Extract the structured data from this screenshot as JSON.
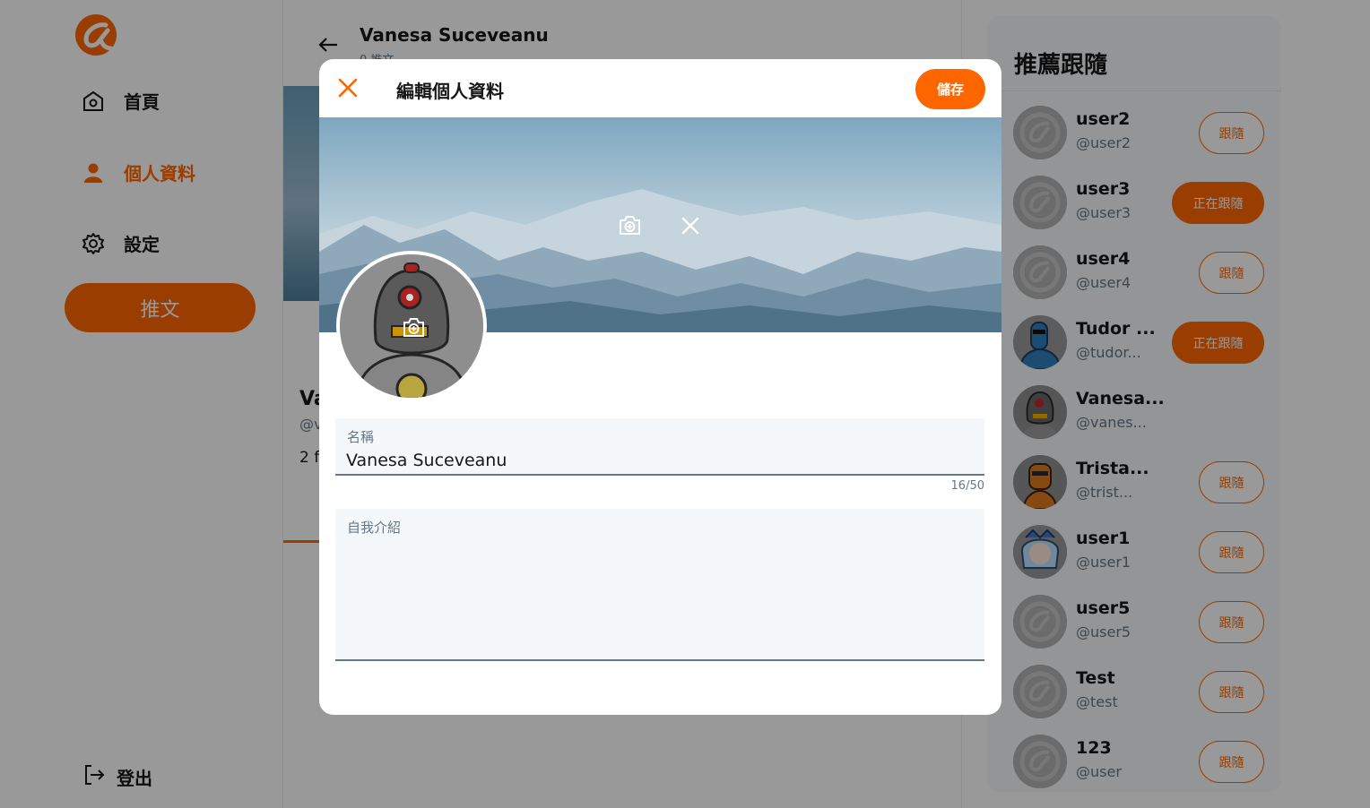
{
  "nav": {
    "items": [
      {
        "label": "首頁",
        "icon": "home-icon",
        "active": false
      },
      {
        "label": "個人資料",
        "icon": "user-icon",
        "active": true
      },
      {
        "label": "設定",
        "icon": "gear-icon",
        "active": false
      }
    ],
    "tweet_label": "推文",
    "logout_label": "登出"
  },
  "profile": {
    "name": "Vanesa Suceveanu",
    "tweet_count": "0 推文",
    "name_partial": "Va",
    "handle_partial": "@v",
    "follow_partial": "2 f"
  },
  "modal": {
    "title": "編輯個人資料",
    "save_label": "儲存",
    "name_label": "名稱",
    "name_value": "Vanesa Suceveanu",
    "name_counter": "16/50",
    "bio_label": "自我介紹",
    "bio_value": ""
  },
  "suggestions": {
    "title": "推薦跟隨",
    "users": [
      {
        "name": "user2",
        "handle": "@user2",
        "button": "跟隨",
        "state": "follow",
        "avatar": "default-logo"
      },
      {
        "name": "user3",
        "handle": "@user3",
        "button": "正在跟隨",
        "state": "following",
        "avatar": "default-logo"
      },
      {
        "name": "user4",
        "handle": "@user4",
        "button": "跟隨",
        "state": "follow",
        "avatar": "default-logo"
      },
      {
        "name": "Tudor ...",
        "handle": "@tudor...",
        "button": "正在跟隨",
        "state": "following",
        "avatar": "blue-robot"
      },
      {
        "name": "Vanesa...",
        "handle": "@vanes...",
        "button": "",
        "state": "self",
        "avatar": "grey-robot"
      },
      {
        "name": "Trista...",
        "handle": "@trist...",
        "button": "跟隨",
        "state": "follow",
        "avatar": "orange-robot"
      },
      {
        "name": "user1",
        "handle": "@user1",
        "button": "跟隨",
        "state": "follow",
        "avatar": "anime-girl"
      },
      {
        "name": "user5",
        "handle": "@user5",
        "button": "跟隨",
        "state": "follow",
        "avatar": "default-logo"
      },
      {
        "name": "Test",
        "handle": "@test",
        "button": "跟隨",
        "state": "follow",
        "avatar": "default-logo"
      },
      {
        "name": "123",
        "handle": "@user",
        "button": "跟隨",
        "state": "follow",
        "avatar": "default-logo"
      }
    ]
  },
  "colors": {
    "accent": "#ff6600",
    "overlay": "rgba(0,0,0,0.4)",
    "muted": "#657786"
  }
}
